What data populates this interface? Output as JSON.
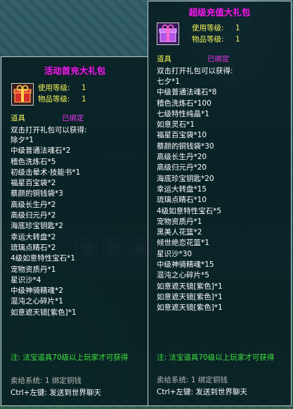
{
  "left_panel": {
    "title": "活动首充大礼包",
    "use_level_label": "使用等级:",
    "use_level_value": "1",
    "item_level_label": "物品等级:",
    "item_level_value": "1",
    "category": "道具",
    "bind_status": "已绑定",
    "intro": "双击打开礼包可以获得:",
    "items": [
      "除夕*1",
      "中级普通法魂石*2",
      "稽色洗炼石*5",
      "初级击晕术·技能书*1",
      "福星百宝袋*2",
      "蔡颜的铜钱袋*3",
      "高级长生丹*2",
      "高级归元丹*2",
      "海底珍宝钥匙*2",
      "幸运大转盘*2",
      "琉璃点睛石*2",
      "4级如意特性宝石*1",
      "宠物资质丹*1",
      "星识沙*4",
      "中级神骑精魂*2",
      "混沌之心碎片*1",
      "如意遮天镜[紫色]*1"
    ],
    "note": "注: 法宝道具70级以上玩家才可获得",
    "sell_label": "卖给系统: 1 绑定铜钱",
    "shortcut": "Ctrl+左键: 发送到世界聊天"
  },
  "right_panel": {
    "title": "超级充值大礼包",
    "use_level_label": "使用等级:",
    "use_level_value": "1",
    "item_level_label": "物品等级:",
    "item_level_value": "1",
    "category": "道具",
    "bind_status": "已绑定",
    "intro": "双击打开礼包可以获得:",
    "items": [
      "七夕*1",
      "中级普通法魂石*8",
      "稽色洗炼石*100",
      "七级特性纯晶*1",
      "如意灵石*1",
      "福星百宝袋*10",
      "蔡颜的铜钱袋*30",
      "高级长生丹*20",
      "高级归元丹*20",
      "海底珍宝钥匙*20",
      "幸运大转盘*15",
      "琉璃点睛石*10",
      "4级如意特性宝石*5",
      "宠物资质丹*1",
      "黑美人花篮*2",
      "倾世绝恋花篮*1",
      "星识沙*30",
      "中级神骑精魂*15",
      "混沌之心碎片*5",
      "如意遮天镜[紫色]*1",
      "如意遮天镜[紫色]*1",
      "如意遮天镜[紫色]*1"
    ],
    "note": "注: 法宝道具70级以上玩家才可获得",
    "sell_label": "卖给系统: 1 绑定铜钱",
    "shortcut": "Ctrl+左键: 发送到世界聊天"
  },
  "colors": {
    "title": "#ee1fee",
    "meta": "#f2f25a",
    "note": "#3fe03f",
    "panel_bg": "#061c20"
  }
}
